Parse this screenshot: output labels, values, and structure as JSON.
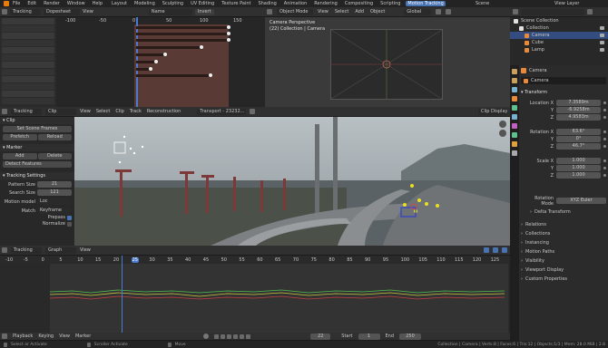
{
  "topbar": {
    "menus": [
      "File",
      "Edit",
      "Render",
      "Window",
      "Help"
    ],
    "workspaces": [
      "Layout",
      "Modeling",
      "Sculpting",
      "UV Editing",
      "Texture Paint",
      "Shading",
      "Animation",
      "Rendering",
      "Compositing",
      "Scripting",
      "Motion Tracking"
    ],
    "active_workspace": "Motion Tracking",
    "scene": "Scene",
    "view_layer": "View Layer"
  },
  "dopesheet": {
    "editor": "Tracking",
    "mode": "Dopesheet",
    "view": "View",
    "sort": "Name",
    "invert": "Invert",
    "ruler": [
      "-100",
      "-50",
      "0",
      "50",
      "100",
      "150"
    ]
  },
  "viewport": {
    "mode": "Object Mode",
    "menus": [
      "View",
      "Select",
      "Add",
      "Object"
    ],
    "orientation": "Global",
    "title": "Camera Perspective",
    "collection": "(22) Collection | Camera"
  },
  "outliner": {
    "title": "Scene Collection",
    "items": [
      {
        "label": "Collection"
      },
      {
        "label": "Camera"
      },
      {
        "label": "Cube"
      },
      {
        "label": "Lamp"
      }
    ]
  },
  "properties": {
    "object": "Camera",
    "name": "Camera",
    "transform_title": "Transform",
    "location": [
      {
        "axis": "Location X",
        "value": "7.3589m"
      },
      {
        "axis": "Y",
        "value": "-6.9258m"
      },
      {
        "axis": "Z",
        "value": "4.9583m"
      }
    ],
    "rotation": [
      {
        "axis": "Rotation X",
        "value": "63.6°"
      },
      {
        "axis": "Y",
        "value": "0°"
      },
      {
        "axis": "Z",
        "value": "46.7°"
      }
    ],
    "scale": [
      {
        "axis": "Scale X",
        "value": "1.000"
      },
      {
        "axis": "Y",
        "value": "1.000"
      },
      {
        "axis": "Z",
        "value": "1.000"
      }
    ],
    "rotation_mode_label": "Rotation Mode",
    "rotation_mode": "XYZ Euler",
    "sections": [
      "Delta Transform",
      "Relations",
      "Collections",
      "Instancing",
      "Motion Paths",
      "Visibility",
      "Viewport Display",
      "Custom Properties"
    ]
  },
  "clip_toolbar": {
    "editor": "Tracking",
    "clip": "Clip",
    "menus": [
      "View",
      "Select",
      "Clip",
      "Track",
      "Reconstruction"
    ],
    "file": "Transport - 23232...",
    "display": "Clip Display"
  },
  "tool_panel": {
    "clip_title": "Clip",
    "set_scene_frames": "Set Scene Frames",
    "prefetch": "Prefetch",
    "reload": "Reload",
    "marker_title": "Marker",
    "add": "Add",
    "delete": "Delete",
    "detect": "Detect Features",
    "settings_title": "Tracking Settings",
    "pattern_size_label": "Pattern Size",
    "pattern_size": "21",
    "search_size_label": "Search Size",
    "search_size": "121",
    "motion_model_label": "Motion model",
    "motion_model": "Loc",
    "match_label": "Match",
    "match": "Keyframe",
    "prepass": "Prepass",
    "normalize": "Normalize"
  },
  "graph": {
    "editor": "Tracking",
    "mode": "Graph",
    "view": "View",
    "ruler": [
      "-10",
      "-5",
      "0",
      "5",
      "10",
      "15",
      "20",
      "25",
      "30",
      "35",
      "40",
      "45",
      "50",
      "55",
      "60",
      "65",
      "70",
      "75",
      "80",
      "85",
      "90",
      "95",
      "100",
      "105",
      "110",
      "115",
      "120",
      "125"
    ]
  },
  "timeline": {
    "playback": "Playback",
    "keying": "Keying",
    "view": "View",
    "marker": "Marker",
    "current": "22",
    "start_label": "Start",
    "start": "1",
    "end_label": "End",
    "end": "250"
  },
  "statusbar": {
    "select": "Select or Activate",
    "scroll": "Scroller Activate",
    "move": "Move",
    "info": "Collection | Camera | Verts:8 | Faces:6 | Tris:12 | Objects:1/3 | Mem: 28.0 MiB | 2.8"
  }
}
